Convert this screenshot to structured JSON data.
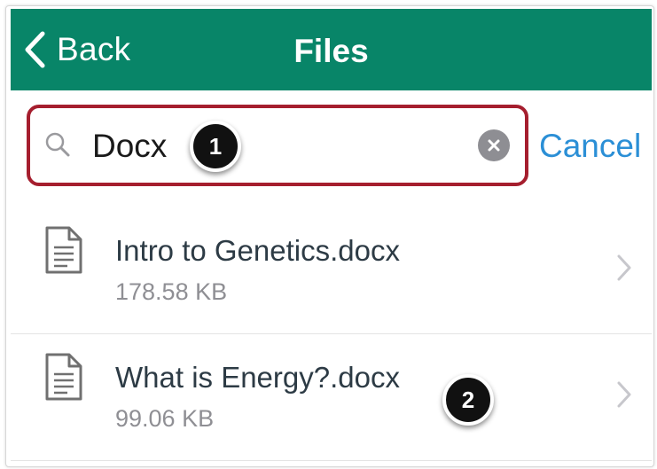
{
  "navbar": {
    "back_label": "Back",
    "title": "Files",
    "back_icon": "chevron-left-icon",
    "color": "#088568"
  },
  "search": {
    "value": "Docx",
    "search_icon": "search-icon",
    "clear_icon": "clear-circle-icon",
    "cancel_label": "Cancel",
    "highlight_color": "#a51e2e"
  },
  "callouts": [
    "1",
    "2"
  ],
  "files": [
    {
      "name": "Intro to Genetics.docx",
      "size": "178.58 KB",
      "icon": "document-icon"
    },
    {
      "name": "What is Energy?.docx",
      "size": "99.06 KB",
      "icon": "document-icon"
    }
  ]
}
